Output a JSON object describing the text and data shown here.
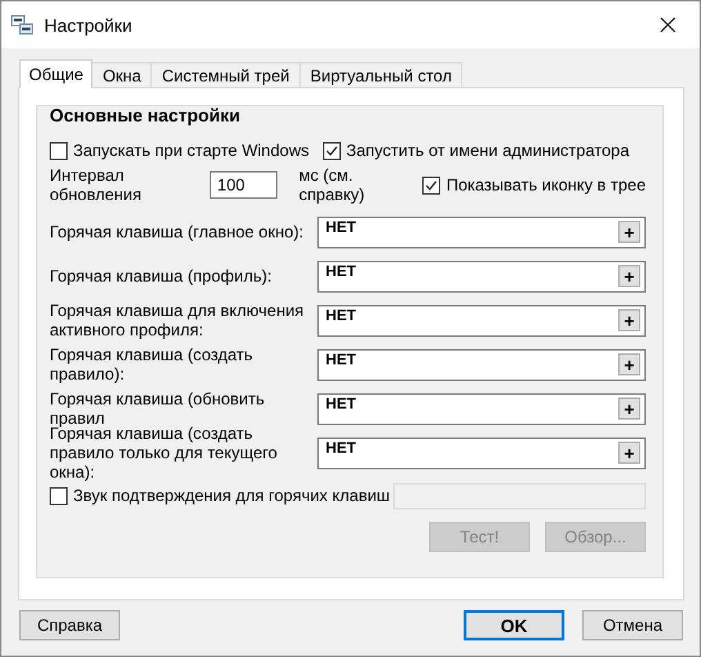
{
  "window": {
    "title": "Настройки"
  },
  "tabs": [
    {
      "label": "Общие",
      "selected": true
    },
    {
      "label": "Окна",
      "selected": false
    },
    {
      "label": "Системный трей",
      "selected": false
    },
    {
      "label": "Виртуальный стол",
      "selected": false
    }
  ],
  "group": {
    "title": "Основные настройки",
    "startup_options": [
      {
        "label": "Запускать при старте Windows",
        "checked": false
      },
      {
        "label": "Запустить от имени администратора",
        "checked": true
      }
    ],
    "interval": {
      "label": "Интервал обновления",
      "value": "100",
      "unit": "мс (см. справку)"
    },
    "tray_option": {
      "label": "Показывать иконку в трее",
      "checked": true
    },
    "hotkeys": [
      {
        "label": "Горячая клавиша (главное окно):",
        "value": "НЕТ",
        "add": "+"
      },
      {
        "label": "Горячая клавиша (профиль):",
        "value": "НЕТ",
        "add": "+"
      },
      {
        "label": "Горячая клавиша для включения активного профиля:",
        "value": "НЕТ",
        "add": "+"
      },
      {
        "label": "Горячая клавиша (создать правило):",
        "value": "НЕТ",
        "add": "+"
      },
      {
        "label": "Горячая клавиша (обновить правил",
        "value": "НЕТ",
        "add": "+"
      },
      {
        "label": "Горячая клавиша (создать правило только для текущего окна):",
        "value": "НЕТ",
        "add": "+"
      }
    ],
    "sound": {
      "label": "Звук подтверждения для горячих клавиш",
      "checked": false,
      "field_disabled": true
    },
    "sound_buttons": [
      {
        "label": "Тест!",
        "disabled": true
      },
      {
        "label": "Обзор...",
        "disabled": true
      }
    ]
  },
  "buttons": [
    {
      "label": "Справка",
      "default": false
    },
    {
      "label": "OK",
      "default": true
    },
    {
      "label": "Отмена",
      "default": false
    }
  ]
}
